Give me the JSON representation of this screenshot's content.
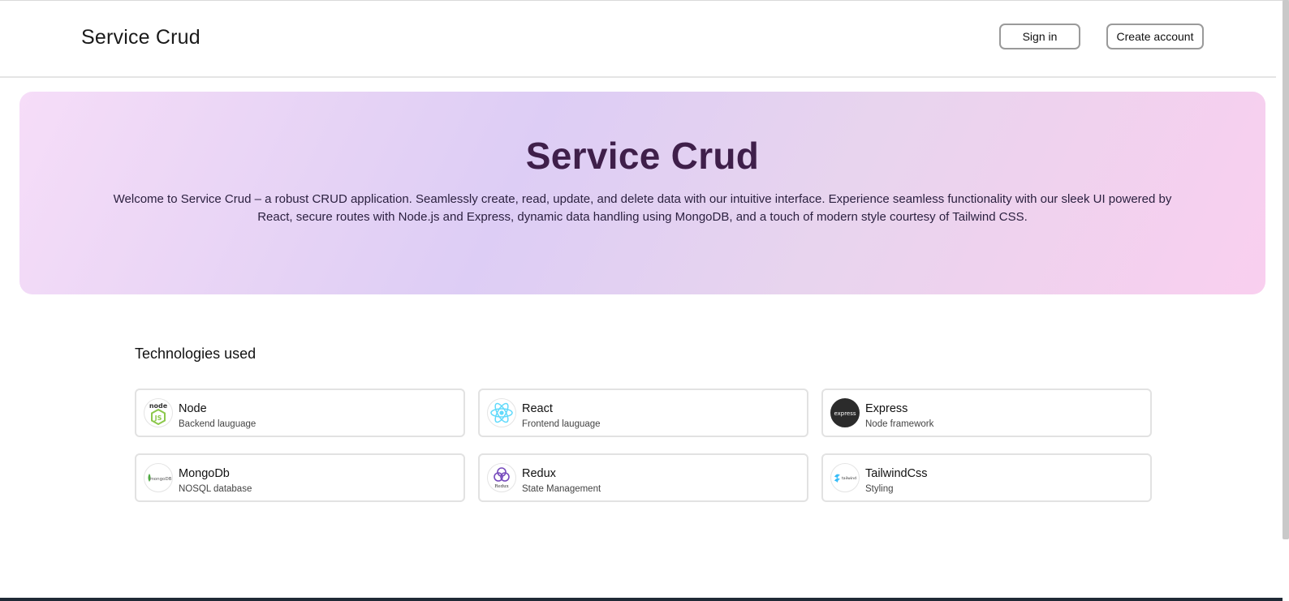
{
  "header": {
    "brand": "Service Crud",
    "signin_label": "Sign in",
    "create_label": "Create account"
  },
  "hero": {
    "title": "Service Crud",
    "description": "Welcome to Service Crud – a robust CRUD application. Seamlessly create, read, update, and delete data with our intuitive interface. Experience seamless functionality with our sleek UI powered by React, secure routes with Node.js and Express, dynamic data handling using MongoDB, and a touch of modern style courtesy of Tailwind CSS."
  },
  "technologies": {
    "title": "Technologies used",
    "items": [
      {
        "name": "Node",
        "desc": "Backend lauguage",
        "icon": "nodejs-icon",
        "logo_text": "node"
      },
      {
        "name": "React",
        "desc": "Frontend lauguage",
        "icon": "react-icon"
      },
      {
        "name": "Express",
        "desc": "Node framework",
        "icon": "express-icon",
        "logo_text": "express"
      },
      {
        "name": "MongoDb",
        "desc": "NOSQL database",
        "icon": "mongodb-icon",
        "logo_text": "mongoDB"
      },
      {
        "name": "Redux",
        "desc": "State Management",
        "icon": "redux-icon",
        "logo_text": "Redux"
      },
      {
        "name": "TailwindCss",
        "desc": "Styling",
        "icon": "tailwindcss-icon",
        "logo_text": "tailwind"
      }
    ]
  },
  "colors": {
    "hero_title": "#3f1f4a",
    "react": "#61dafb",
    "node_green": "#8cc84b",
    "redux_purple": "#764abc",
    "tailwind_teal": "#38bdf8"
  }
}
